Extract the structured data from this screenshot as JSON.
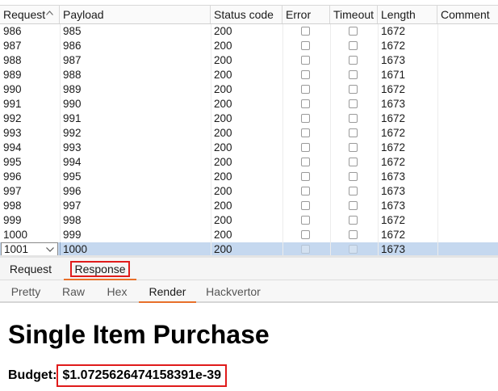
{
  "table": {
    "columns": [
      {
        "key": "request",
        "label": "Request"
      },
      {
        "key": "payload",
        "label": "Payload"
      },
      {
        "key": "status",
        "label": "Status code"
      },
      {
        "key": "error",
        "label": "Error"
      },
      {
        "key": "timeout",
        "label": "Timeout"
      },
      {
        "key": "length",
        "label": "Length"
      },
      {
        "key": "comment",
        "label": "Comment"
      }
    ],
    "sort_icon": "chevron-up-icon",
    "rows": [
      {
        "request": "986",
        "payload": "985",
        "status": "200",
        "length": "1672"
      },
      {
        "request": "987",
        "payload": "986",
        "status": "200",
        "length": "1672"
      },
      {
        "request": "988",
        "payload": "987",
        "status": "200",
        "length": "1673"
      },
      {
        "request": "989",
        "payload": "988",
        "status": "200",
        "length": "1671"
      },
      {
        "request": "990",
        "payload": "989",
        "status": "200",
        "length": "1672"
      },
      {
        "request": "991",
        "payload": "990",
        "status": "200",
        "length": "1673"
      },
      {
        "request": "992",
        "payload": "991",
        "status": "200",
        "length": "1672"
      },
      {
        "request": "993",
        "payload": "992",
        "status": "200",
        "length": "1672"
      },
      {
        "request": "994",
        "payload": "993",
        "status": "200",
        "length": "1672"
      },
      {
        "request": "995",
        "payload": "994",
        "status": "200",
        "length": "1672"
      },
      {
        "request": "996",
        "payload": "995",
        "status": "200",
        "length": "1673"
      },
      {
        "request": "997",
        "payload": "996",
        "status": "200",
        "length": "1673"
      },
      {
        "request": "998",
        "payload": "997",
        "status": "200",
        "length": "1673"
      },
      {
        "request": "999",
        "payload": "998",
        "status": "200",
        "length": "1672"
      },
      {
        "request": "1000",
        "payload": "999",
        "status": "200",
        "length": "1672"
      }
    ],
    "selected_row": {
      "request": "1001",
      "payload": "1000",
      "status": "200",
      "length": "1673"
    },
    "selected_row_icon": "chevron-down-icon"
  },
  "message_tabs": {
    "items": [
      "Request",
      "Response"
    ],
    "active": "Response"
  },
  "view_tabs": {
    "items": [
      "Pretty",
      "Raw",
      "Hex",
      "Render",
      "Hackvertor"
    ],
    "active": "Render"
  },
  "render": {
    "heading": "Single Item Purchase",
    "budget_label": "Budget:",
    "budget_value": "$1.0725626474158391e-39"
  },
  "colors": {
    "selected_row": "#c5d8ef",
    "active_tab_underline": "#e8702a",
    "highlight_box": "#e01b1b"
  }
}
